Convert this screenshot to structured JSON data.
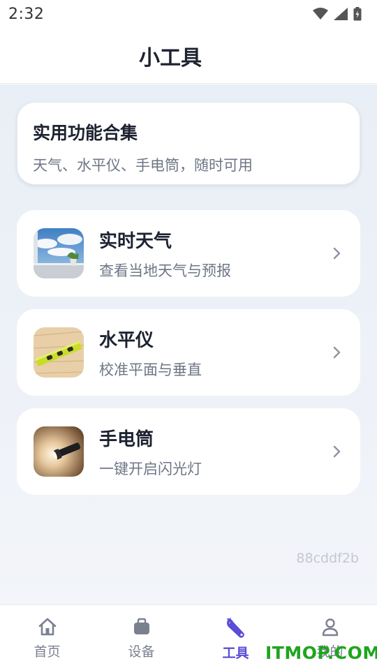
{
  "status_bar": {
    "time": "2:32"
  },
  "header": {
    "title": "小工具"
  },
  "intro_card": {
    "title": "实用功能合集",
    "subtitle": "天气、水平仪、手电筒，随时可用"
  },
  "tools": [
    {
      "title": "实时天气",
      "subtitle": "查看当地天气与预报",
      "icon": "weather-photo"
    },
    {
      "title": "水平仪",
      "subtitle": "校准平面与垂直",
      "icon": "spirit-level-photo"
    },
    {
      "title": "手电筒",
      "subtitle": "一键开启闪光灯",
      "icon": "flashlight-photo"
    }
  ],
  "version": "88cddf2b",
  "nav": {
    "items": [
      {
        "label": "首页",
        "icon": "home-icon"
      },
      {
        "label": "设备",
        "icon": "briefcase-icon"
      },
      {
        "label": "工具",
        "icon": "wrench-icon",
        "active": true
      },
      {
        "label": "我的",
        "icon": "person-icon"
      }
    ]
  },
  "watermark": "ITMOP.COM",
  "colors": {
    "accent": "#5a4cd8",
    "background": "#e9eff6",
    "card": "#ffffff"
  }
}
